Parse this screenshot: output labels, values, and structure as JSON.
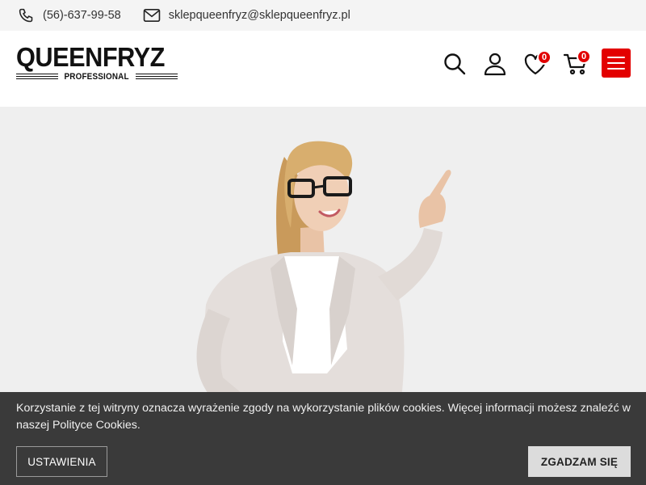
{
  "contact": {
    "phone": "(56)-637-99-58",
    "email": "sklepqueenfryz@sklepqueenfryz.pl"
  },
  "logo": {
    "main": "QUEENFRYZ",
    "sub": "PROFESSIONAL"
  },
  "header": {
    "wishlist_count": "0",
    "cart_count": "0"
  },
  "cookie": {
    "message": "Korzystanie z tej witryny oznacza wyrażenie zgody na wykorzystanie plików cookies. Więcej informacji możesz znaleźć w naszej Polityce Cookies.",
    "settings_label": "USTAWIENIA",
    "agree_label": "ZGADZAM SIĘ"
  },
  "colors": {
    "accent": "#e30000",
    "topbar_bg": "#f4f4f4",
    "hero_bg": "#efefef",
    "cookie_bg": "#3a3a3a"
  }
}
